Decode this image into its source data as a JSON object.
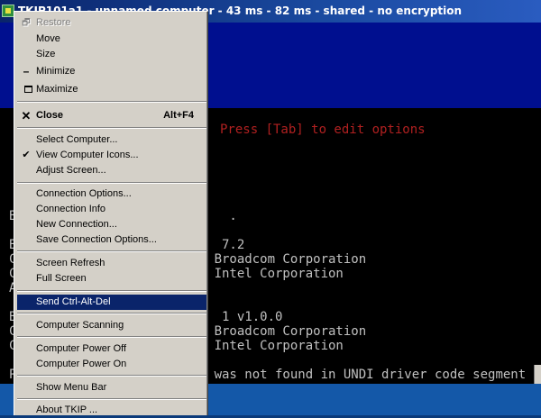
{
  "window": {
    "title": "TKIP101a1 - unnamed computer - 43 ms - 82 ms - shared - no encryption"
  },
  "console": {
    "banner": "Press [Tab] to edit options",
    "lines": [
      "B                            .",
      "B                           7.2",
      "C                          Broadcom Corporation",
      "C                          Intel Corporation",
      "A",
      "B                           1 v1.0.0",
      "C                          Broadcom Corporation",
      "C                          Intel Corporation",
      "P                          was not found in UNDI driver code segment"
    ]
  },
  "menu": {
    "restore": "Restore",
    "move": "Move",
    "size": "Size",
    "minimize": "Minimize",
    "maximize": "Maximize",
    "close": "Close",
    "close_accel": "Alt+F4",
    "select_computer": "Select Computer...",
    "view_computer_icons": "View Computer Icons...",
    "adjust_screen": "Adjust Screen...",
    "connection_options": "Connection Options...",
    "connection_info": "Connection Info",
    "new_connection": "New Connection...",
    "save_connection_options": "Save Connection Options...",
    "screen_refresh": "Screen Refresh",
    "full_screen": "Full Screen",
    "send_ctrl_alt_del": "Send Ctrl-Alt-Del",
    "computer_scanning": "Computer Scanning",
    "computer_power_off": "Computer Power Off",
    "computer_power_on": "Computer Power On",
    "show_menu_bar": "Show Menu Bar",
    "about": "About TKIP ..."
  },
  "colors": {
    "title_bar": "#0a246a",
    "desktop_band": "#000f8f",
    "console_bg": "#000000",
    "banner_text": "#b02020",
    "menu_bg": "#d4d0c8",
    "menu_highlight": "#0a246a"
  }
}
